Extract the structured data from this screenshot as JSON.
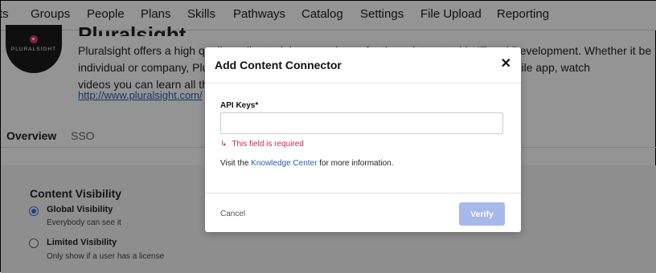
{
  "nav": {
    "items": [
      "ts",
      "Groups",
      "People",
      "Plans",
      "Skills",
      "Pathways",
      "Catalog",
      "Settings",
      "File Upload",
      "Reporting"
    ]
  },
  "company": {
    "logo_text": "PLURALSIGHT",
    "name": "Pluralsight",
    "description_lines": [
      "Pluralsight offers a high quality online training experience for those interested in IT and Development. Whether it be for",
      "individual or company, Pluralsight can help you achieve your goals. With use of their mobile app, watch",
      "videos you can learn all the skills you need, wherever you are."
    ],
    "link": "http://www.pluralsight.com/"
  },
  "tabs": {
    "overview": "Overview",
    "sso": "SSO"
  },
  "content_visibility": {
    "title": "Content Visibility",
    "options": [
      {
        "label": "Global Visibility",
        "sub": "Everybody can see it",
        "checked": true
      },
      {
        "label": "Limited Visibility",
        "sub": "Only show if a user has a license",
        "checked": false
      }
    ]
  },
  "modal": {
    "title": "Add Content Connector",
    "close": "✕",
    "field_label": "API Keys*",
    "field_value": "",
    "error_arrow": "↳",
    "error": "This field is required",
    "info_prefix": "Visit the ",
    "info_link": "Knowledge Center",
    "info_suffix": " for more information.",
    "cancel": "Cancel",
    "verify": "Verify"
  }
}
